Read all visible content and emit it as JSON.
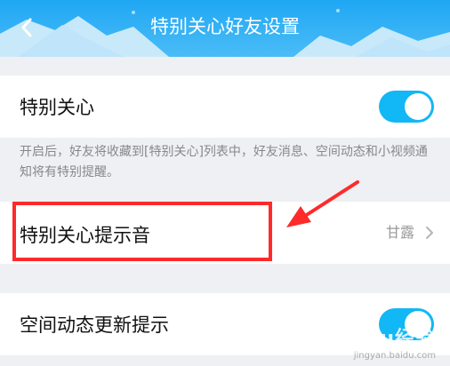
{
  "header": {
    "title": "特别关心好友设置"
  },
  "settings": {
    "special_care": {
      "label": "特别关心",
      "enabled": true
    },
    "description": "开启后，好友将收藏到[特别关心]列表中，好友消息、空间动态和小视频通知将有特别提醒。",
    "alert_tone": {
      "label": "特别关心提示音",
      "value": "甘露"
    },
    "qzone_updates": {
      "label": "空间动态更新提示",
      "enabled": true
    }
  },
  "watermark": {
    "brand": "Baidu经验",
    "url": "jingyan.baidu.com"
  },
  "colors": {
    "header": "#1fa7f4",
    "toggle_on": "#12b7f5",
    "annotation": "#ff2a2a"
  }
}
